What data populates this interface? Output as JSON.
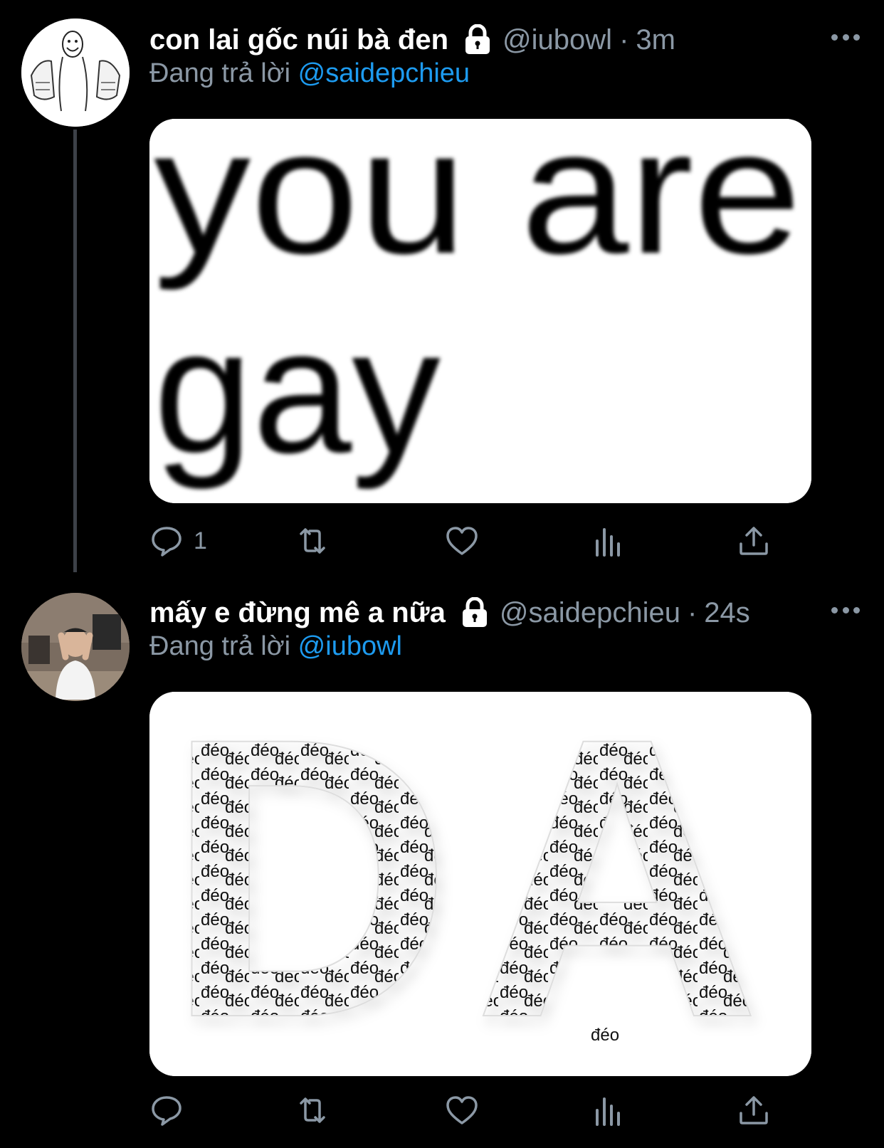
{
  "tweets": [
    {
      "display_name": "con lai gốc núi bà đen",
      "handle": "@iubowl",
      "separator": "·",
      "time": "3m",
      "replying_prefix": "Đang trả lời",
      "replying_to": "@saidepchieu",
      "media_text_line1": "you are",
      "media_text_line2": "gay",
      "reply_count": "1",
      "icons": [
        "lock-icon",
        "more-icon",
        "reply-icon",
        "retweet-icon",
        "like-icon",
        "stats-icon",
        "share-icon"
      ]
    },
    {
      "display_name": "mấy e đừng mê a nữa",
      "handle": "@saidepchieu",
      "separator": "·",
      "time": "24s",
      "replying_prefix": "Đang trả lời",
      "replying_to": "@iubowl",
      "media_letters": [
        "D",
        "A"
      ],
      "media_fill_word": "đéo",
      "reply_count": "",
      "icons": [
        "lock-icon",
        "more-icon",
        "reply-icon",
        "retweet-icon",
        "like-icon",
        "stats-icon",
        "share-icon"
      ]
    }
  ],
  "colors": {
    "background": "#000000",
    "secondary_text": "#8b98a5",
    "mention": "#1d9bf0",
    "thread_line": "#3d4148"
  }
}
